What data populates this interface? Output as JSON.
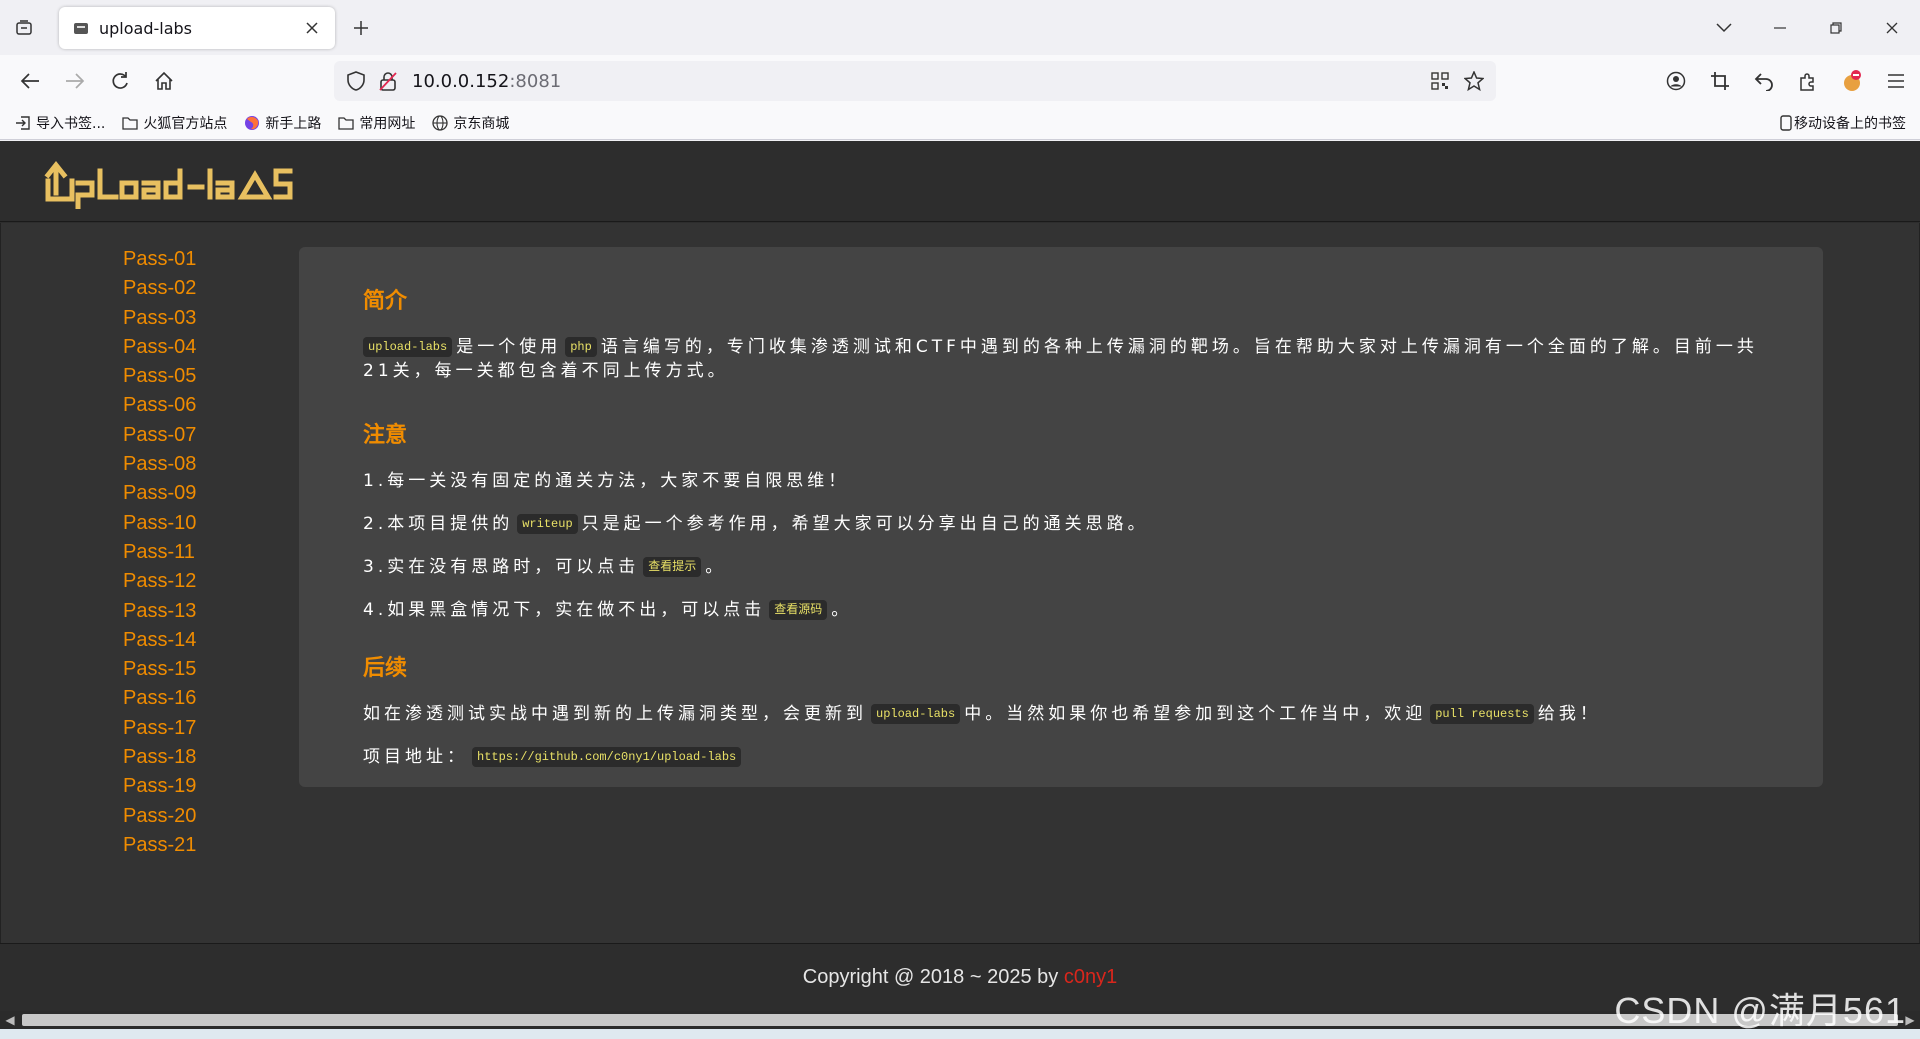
{
  "browser": {
    "tab_title": "upload-labs",
    "url_host": "10.0.0.152",
    "url_port": ":8081",
    "bookmarks": [
      {
        "label": "导入书签..."
      },
      {
        "label": "火狐官方站点"
      },
      {
        "label": "新手上路"
      },
      {
        "label": "常用网址"
      },
      {
        "label": "京东商城"
      }
    ],
    "bookmark_right": "移动设备上的书签"
  },
  "site": {
    "logo_text": "UpLoad-labs",
    "passes": [
      "Pass-01",
      "Pass-02",
      "Pass-03",
      "Pass-04",
      "Pass-05",
      "Pass-06",
      "Pass-07",
      "Pass-08",
      "Pass-09",
      "Pass-10",
      "Pass-11",
      "Pass-12",
      "Pass-13",
      "Pass-14",
      "Pass-15",
      "Pass-16",
      "Pass-17",
      "Pass-18",
      "Pass-19",
      "Pass-20",
      "Pass-21"
    ],
    "intro": {
      "heading": "简介",
      "code1": "upload-labs",
      "t1": "是一个使用",
      "code2": "php",
      "t2": "语言编写的，专门收集渗透测试和CTF中遇到的各种上传漏洞的靶场。旨在帮助大家对上传漏洞有一个全面的了解。目前一共21关，每一关都包含着不同上传方式。"
    },
    "notes": {
      "heading": "注意",
      "n1": "1.每一关没有固定的通关方法，大家不要自限思维！",
      "n2_a": "2.本项目提供的",
      "n2_code": "writeup",
      "n2_b": "只是起一个参考作用，希望大家可以分享出自己的通关思路。",
      "n3_a": "3.实在没有思路时，可以点击",
      "n3_code": "查看提示",
      "n3_b": "。",
      "n4_a": "4.如果黑盒情况下，实在做不出，可以点击",
      "n4_code": "查看源码",
      "n4_b": "。"
    },
    "followup": {
      "heading": "后续",
      "p1_a": "如在渗透测试实战中遇到新的上传漏洞类型，会更新到",
      "p1_code": "upload-labs",
      "p1_b": "中。当然如果你也希望参加到这个工作当中，欢迎",
      "p1_code2": "pull requests",
      "p1_c": "给我！",
      "addr_label": "项目地址：",
      "addr_code": "https://github.com/c0ny1/upload-labs"
    },
    "footer": {
      "copyright": "Copyright @ 2018 ~ 2025 by ",
      "author": "c0ny1"
    }
  },
  "watermark": "CSDN @满月561",
  "colors": {
    "accent": "#f08c00",
    "page_bg": "#333333",
    "panel_bg": "#444444",
    "code_text": "#e8e066",
    "author": "#d9261c"
  }
}
